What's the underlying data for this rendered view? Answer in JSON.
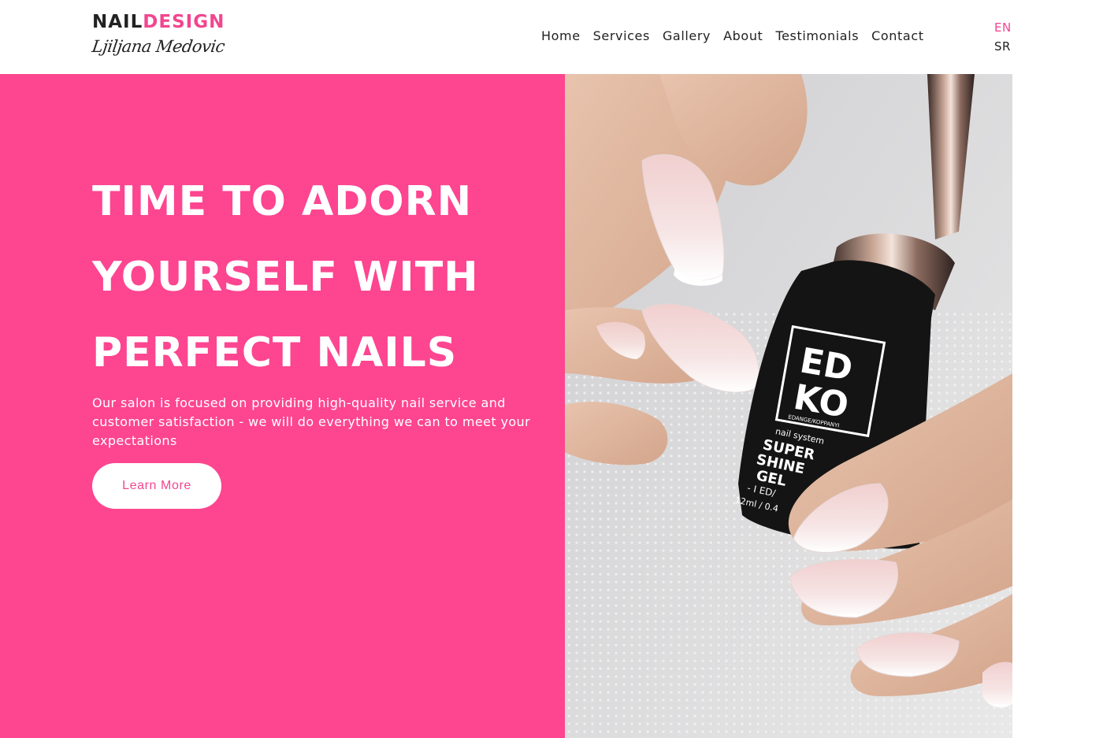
{
  "header": {
    "logo_part1": "NAIL",
    "logo_part2": "DESIGN",
    "logo_signature": "Ljiljana Medovic",
    "nav": [
      "Home",
      "Services",
      "Gallery",
      "About",
      "Testimonials",
      "Contact"
    ],
    "languages": {
      "active": "EN",
      "other": "SR"
    }
  },
  "hero": {
    "title_lines": [
      "TIME TO ADORN",
      "YOURSELF WITH",
      "PERFECT NAILS"
    ],
    "description": "Our salon is focused on providing high-quality nail service and customer satisfaction - we will do everything we can to meet your expectations",
    "button_label": "Learn More",
    "bottle_brand_line1": "ED",
    "bottle_brand_line2": "KO",
    "bottle_small_text": "EDANGE/KOPPANYI",
    "bottle_label": [
      "nail system",
      "SUPER",
      "SHINE",
      "GEL",
      "- I ED/",
      "12ml / 0.4"
    ]
  },
  "colors": {
    "accent": "#fd4590",
    "accent_text": "#f2468f",
    "text": "#222222",
    "background": "#ffffff"
  }
}
